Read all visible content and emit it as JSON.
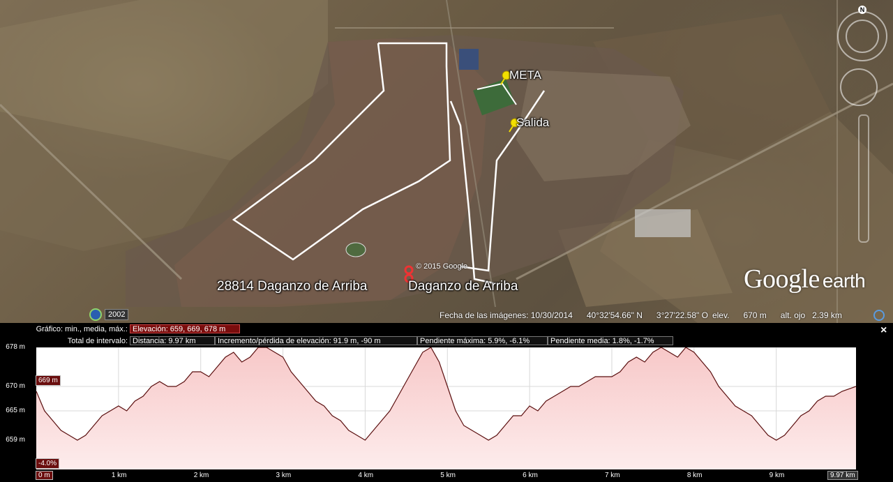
{
  "map": {
    "placemarks": {
      "finish": "META",
      "start": "Salida"
    },
    "town_labels": [
      "28814 Daganzo de Arriba",
      "Daganzo de Arriba"
    ],
    "copyright": "© 2015 Google",
    "logo_main": "Google",
    "logo_sub": "earth",
    "history_year": "2002",
    "north_label": "N",
    "status": {
      "imagery_date": "Fecha de las imágenes: 10/30/2014",
      "latitude": "40°32'54.66\" N",
      "longitude": "3°27'22.58\" O",
      "elev_label": "elev.",
      "elev_value": "670 m",
      "eye_label": "alt. ojo",
      "eye_value": "2.39 km"
    },
    "icons": {
      "placemark": "yellow-pushpin-icon",
      "search_result": "red-location-pin-icon",
      "history": "clock-icon",
      "atmosphere": "atmosphere-icon",
      "compass": "compass-icon"
    }
  },
  "profile": {
    "row1_label": "Gráfico: min., media, máx.:",
    "elevation_summary": "Elevación: 659, 669, 678 m",
    "row2_label": "Total de intervalo:",
    "distance": "Distancia: 9.97 km",
    "gain_loss": "Incremento/pérdida de elevación: 91.9 m, -90 m",
    "max_slope": "Pendiente máxima: 5.9%, -6.1%",
    "avg_slope": "Pendiente media: 1.8%, -1.7%",
    "close": "×",
    "current_elevation": "669 m",
    "current_slope": "-4.0%",
    "x_start": "0 m",
    "x_end": "9.97 km"
  },
  "chart_data": {
    "type": "area",
    "xlabel": "",
    "ylabel": "",
    "x_unit": "km",
    "xlim": [
      0,
      9.97
    ],
    "ylim": [
      653,
      678
    ],
    "y_ticks": [
      678,
      670,
      665,
      659
    ],
    "y_tick_labels": [
      "678 m",
      "670 m",
      "665 m",
      "659 m"
    ],
    "x_ticks": [
      1,
      2,
      3,
      4,
      5,
      6,
      7,
      8,
      9
    ],
    "x_tick_labels": [
      "1 km",
      "2 km",
      "3 km",
      "4 km",
      "5 km",
      "6 km",
      "7 km",
      "8 km",
      "9 km"
    ],
    "grid": true,
    "colors": {
      "line": "#5a0f0f",
      "fill_top": "#f7c8c8",
      "fill_bottom": "#fdecec",
      "grid": "#d8d8d8"
    },
    "series": [
      {
        "x": [
          0,
          0.1,
          0.2,
          0.3,
          0.4,
          0.5,
          0.6,
          0.7,
          0.8,
          0.9,
          1.0,
          1.1,
          1.2,
          1.3,
          1.4,
          1.5,
          1.6,
          1.7,
          1.8,
          1.9,
          2.0,
          2.1,
          2.2,
          2.3,
          2.4,
          2.5,
          2.6,
          2.7,
          2.8,
          2.9,
          3.0,
          3.1,
          3.2,
          3.3,
          3.4,
          3.5,
          3.6,
          3.7,
          3.8,
          3.9,
          4.0,
          4.1,
          4.2,
          4.3,
          4.4,
          4.5,
          4.6,
          4.7,
          4.8,
          4.9,
          5.0,
          5.1,
          5.2,
          5.3,
          5.4,
          5.5,
          5.6,
          5.7,
          5.8,
          5.9,
          6.0,
          6.1,
          6.2,
          6.3,
          6.4,
          6.5,
          6.6,
          6.7,
          6.8,
          6.9,
          7.0,
          7.1,
          7.2,
          7.3,
          7.4,
          7.5,
          7.6,
          7.7,
          7.8,
          7.9,
          8.0,
          8.1,
          8.2,
          8.3,
          8.4,
          8.5,
          8.6,
          8.7,
          8.8,
          8.9,
          9.0,
          9.1,
          9.2,
          9.3,
          9.4,
          9.5,
          9.6,
          9.7,
          9.8,
          9.97
        ],
        "y": [
          669,
          665,
          663,
          661,
          660,
          659,
          660,
          662,
          664,
          665,
          666,
          665,
          667,
          668,
          670,
          671,
          670,
          670,
          671,
          673,
          673,
          672,
          674,
          676,
          677,
          675,
          676,
          678,
          678,
          677,
          676,
          673,
          671,
          669,
          667,
          666,
          664,
          663,
          661,
          660,
          659,
          661,
          663,
          665,
          668,
          671,
          674,
          677,
          678,
          675,
          670,
          665,
          662,
          661,
          660,
          659,
          660,
          662,
          664,
          664,
          666,
          665,
          667,
          668,
          669,
          670,
          670,
          671,
          672,
          672,
          672,
          673,
          675,
          676,
          675,
          677,
          678,
          677,
          676,
          678,
          677,
          675,
          673,
          670,
          668,
          666,
          665,
          664,
          662,
          660,
          659,
          660,
          662,
          664,
          665,
          667,
          668,
          668,
          669,
          670
        ]
      }
    ]
  }
}
